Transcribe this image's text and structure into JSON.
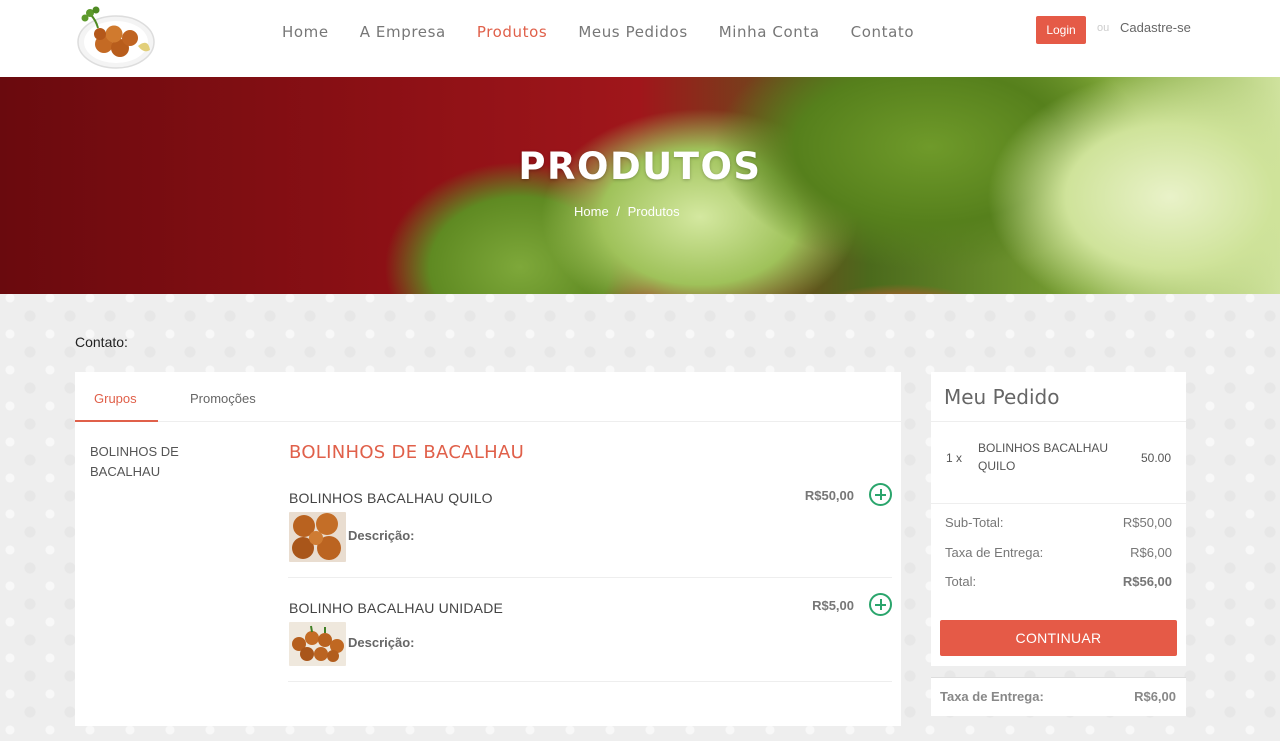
{
  "nav": {
    "items": [
      {
        "label": "Home"
      },
      {
        "label": "A Empresa"
      },
      {
        "label": "Produtos"
      },
      {
        "label": "Meus Pedidos"
      },
      {
        "label": "Minha Conta"
      },
      {
        "label": "Contato"
      }
    ],
    "active": "Produtos"
  },
  "auth": {
    "login_label": "Login",
    "or_text": "ou",
    "signup_label": "Cadastre-se"
  },
  "hero": {
    "title": "PRODUTOS",
    "breadcrumb": [
      "Home",
      "/",
      "Produtos"
    ]
  },
  "contact_label": "Contato:",
  "tabs": [
    {
      "label": "Grupos"
    },
    {
      "label": "Promoções"
    }
  ],
  "groups": [
    {
      "label": "BOLINHOS DE BACALHAU"
    }
  ],
  "category": {
    "title": "BOLINHOS DE BACALHAU",
    "products": [
      {
        "name": "BOLINHOS BACALHAU QUILO",
        "price": "R$50,00",
        "description": "Descrição:"
      },
      {
        "name": "BOLINHO BACALHAU UNIDADE",
        "price": "R$5,00",
        "description": "Descrição:"
      }
    ]
  },
  "order": {
    "title": "Meu Pedido",
    "items": [
      {
        "qty": "1 x",
        "name": "BOLINHOS BACALHAU QUILO",
        "value": "50.00"
      }
    ],
    "subtotal_label": "Sub-Total:",
    "subtotal_value": "R$50,00",
    "delivery_label": "Taxa de Entrega:",
    "delivery_value": "R$6,00",
    "total_label": "Total:",
    "total_value": "R$56,00",
    "continue_label": "CONTINUAR"
  },
  "delivery_box": {
    "label": "Taxa de Entrega:",
    "value": "R$6,00"
  },
  "colors": {
    "accent": "#e0604a",
    "button": "#e55a47",
    "add_icon": "#2aa56c"
  }
}
